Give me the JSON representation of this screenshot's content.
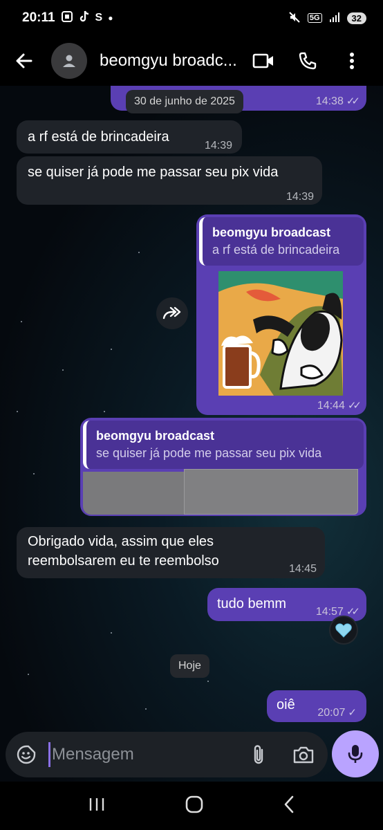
{
  "status_bar": {
    "time": "20:11",
    "app_letter": "S",
    "network": "5G",
    "battery": "32"
  },
  "header": {
    "title": "beomgyu broadc..."
  },
  "date_pill": "30 de junho de 2025",
  "today_pill": "Hoje",
  "messages": [
    {
      "text": "a rf está de brincadeira",
      "time": "14:39"
    },
    {
      "text": "se quiser já pode me passar seu pix vida",
      "time": "14:39"
    },
    {
      "reply_name": "beomgyu broadcast",
      "reply_text": "a rf está de brincadeira",
      "time": "14:44"
    },
    {
      "reply_name": "beomgyu broadcast",
      "reply_text": "se quiser já pode me passar seu pix vida"
    },
    {
      "text_line1": "Obrigado vida, assim que eles",
      "text_line2": "reembolsarem eu te reembolso",
      "time": "14:45"
    },
    {
      "text": "tudo bemm",
      "time": "14:57"
    },
    {
      "text": "oiê",
      "time": "20:07"
    }
  ],
  "top_clipped_time": "14:38",
  "reaction": "light-blue-heart",
  "composer": {
    "placeholder": "Mensagem"
  },
  "colors": {
    "outgoing": "#5a3fb3",
    "incoming": "#1f2329",
    "mic": "#b9a3ff"
  }
}
